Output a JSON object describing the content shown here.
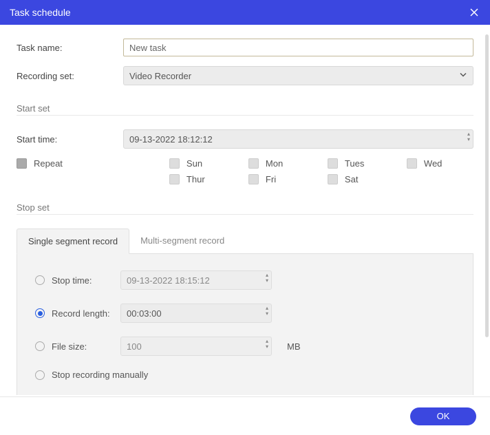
{
  "header": {
    "title": "Task schedule"
  },
  "taskName": {
    "label": "Task name:",
    "value": "New task"
  },
  "recordingSet": {
    "label": "Recording set:",
    "value": "Video Recorder"
  },
  "startSet": {
    "title": "Start set",
    "startTime": {
      "label": "Start time:",
      "value": "09-13-2022 18:12:12"
    },
    "repeat": {
      "label": "Repeat",
      "days": {
        "sun": "Sun",
        "mon": "Mon",
        "tues": "Tues",
        "wed": "Wed",
        "thur": "Thur",
        "fri": "Fri",
        "sat": "Sat"
      }
    }
  },
  "stopSet": {
    "title": "Stop set",
    "tabs": {
      "single": "Single segment record",
      "multi": "Multi-segment record"
    },
    "stopTime": {
      "label": "Stop time:",
      "value": "09-13-2022 18:15:12"
    },
    "recordLength": {
      "label": "Record length:",
      "value": "00:03:00"
    },
    "fileSize": {
      "label": "File size:",
      "value": "100",
      "unit": "MB"
    },
    "manual": {
      "label": "Stop recording manually"
    }
  },
  "footer": {
    "ok": "OK"
  }
}
